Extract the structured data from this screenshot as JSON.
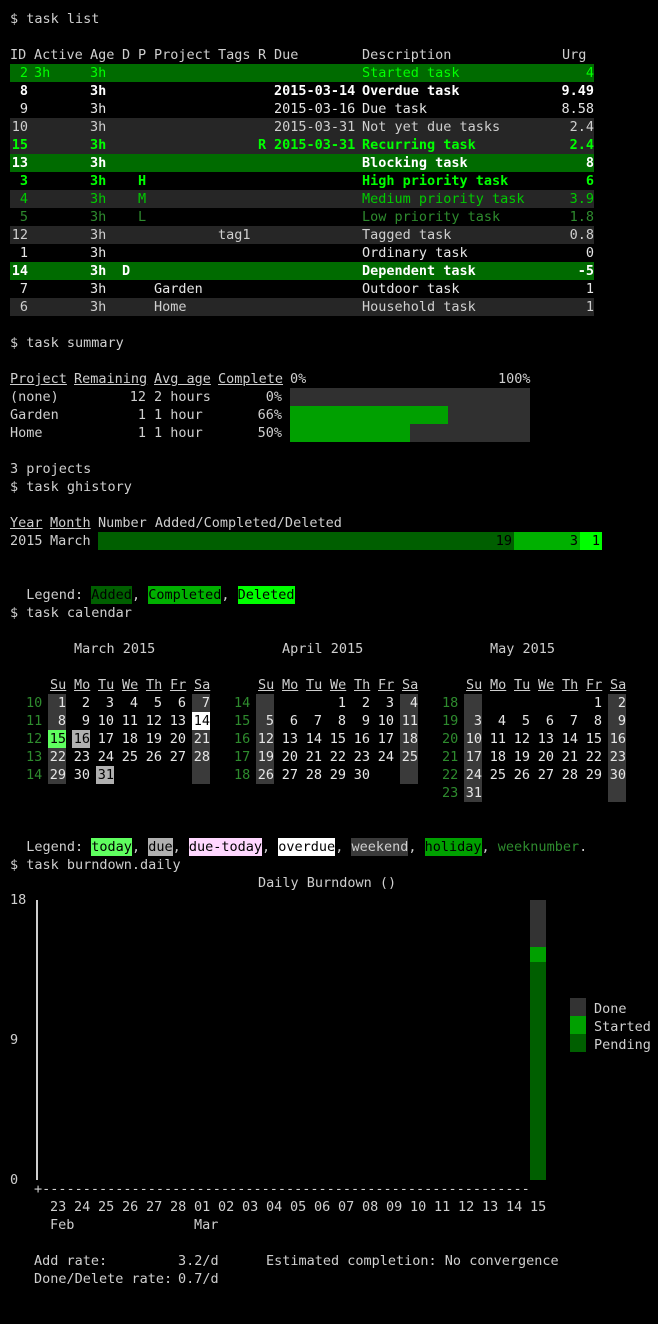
{
  "colors": {
    "background": "#000000",
    "text": "#cfcfcf",
    "gray_row": "#262626",
    "active_bg": "#006b00",
    "bright_green": "#00ff00",
    "mid_green": "#00cc00",
    "dark_green": "#2e8b2e",
    "bar_green": "#00a000",
    "bar_gray": "#303030",
    "added_green": "#005f00",
    "completed_green": "#00b000",
    "deleted_green": "#00ff00",
    "weekend_gray": "#3a3a3a",
    "weeknumber": "#2e8b2e",
    "today": "#5fff5f",
    "due": "#b0b0b0",
    "due_today": "#ffd7ff",
    "overdue": "#ffffff",
    "holiday": "#00a000"
  },
  "list": {
    "command": "$ task list",
    "headers": {
      "id": "ID",
      "active": "Active",
      "age": "Age",
      "d": "D",
      "p": "P",
      "project": "Project",
      "tags": "Tags",
      "r": "R",
      "due": "Due",
      "desc": "Description",
      "urg": "Urg"
    },
    "rows": [
      {
        "id": "2",
        "active": "3h",
        "age": "3h",
        "d": "",
        "p": "",
        "project": "",
        "tags": "",
        "r": "",
        "due": "",
        "desc": "Started task",
        "urg": "4",
        "style": "active"
      },
      {
        "id": "8",
        "active": "",
        "age": "3h",
        "d": "",
        "p": "",
        "project": "",
        "tags": "",
        "r": "",
        "due": "2015-03-14",
        "desc": "Overdue task",
        "urg": "9.49",
        "style": "overdue"
      },
      {
        "id": "9",
        "active": "",
        "age": "3h",
        "d": "",
        "p": "",
        "project": "",
        "tags": "",
        "r": "",
        "due": "2015-03-16",
        "desc": "Due task",
        "urg": "8.58",
        "style": "plain"
      },
      {
        "id": "10",
        "active": "",
        "age": "3h",
        "d": "",
        "p": "",
        "project": "",
        "tags": "",
        "r": "",
        "due": "2015-03-31",
        "desc": "Not yet due tasks",
        "urg": "2.4",
        "style": "gray"
      },
      {
        "id": "15",
        "active": "",
        "age": "3h",
        "d": "",
        "p": "",
        "project": "",
        "tags": "",
        "r": "R",
        "due": "2015-03-31",
        "desc": "Recurring task",
        "urg": "2.4",
        "style": "recurring"
      },
      {
        "id": "13",
        "active": "",
        "age": "3h",
        "d": "",
        "p": "",
        "project": "",
        "tags": "",
        "r": "",
        "due": "",
        "desc": "Blocking task",
        "urg": "8",
        "style": "blocking"
      },
      {
        "id": "3",
        "active": "",
        "age": "3h",
        "d": "",
        "p": "H",
        "project": "",
        "tags": "",
        "r": "",
        "due": "",
        "desc": "High priority task",
        "urg": "6",
        "style": "high"
      },
      {
        "id": "4",
        "active": "",
        "age": "3h",
        "d": "",
        "p": "M",
        "project": "",
        "tags": "",
        "r": "",
        "due": "",
        "desc": "Medium priority task",
        "urg": "3.9",
        "style": "medium"
      },
      {
        "id": "5",
        "active": "",
        "age": "3h",
        "d": "",
        "p": "L",
        "project": "",
        "tags": "",
        "r": "",
        "due": "",
        "desc": "Low priority task",
        "urg": "1.8",
        "style": "low"
      },
      {
        "id": "12",
        "active": "",
        "age": "3h",
        "d": "",
        "p": "",
        "project": "",
        "tags": "tag1",
        "r": "",
        "due": "",
        "desc": "Tagged task",
        "urg": "0.8",
        "style": "gray"
      },
      {
        "id": "1",
        "active": "",
        "age": "3h",
        "d": "",
        "p": "",
        "project": "",
        "tags": "",
        "r": "",
        "due": "",
        "desc": "Ordinary task",
        "urg": "0",
        "style": "plain"
      },
      {
        "id": "14",
        "active": "",
        "age": "3h",
        "d": "D",
        "p": "",
        "project": "",
        "tags": "",
        "r": "",
        "due": "",
        "desc": "Dependent task",
        "urg": "-5",
        "style": "dependent"
      },
      {
        "id": "7",
        "active": "",
        "age": "3h",
        "d": "",
        "p": "",
        "project": "Garden",
        "tags": "",
        "r": "",
        "due": "",
        "desc": "Outdoor task",
        "urg": "1",
        "style": "plain"
      },
      {
        "id": "6",
        "active": "",
        "age": "3h",
        "d": "",
        "p": "",
        "project": "Home",
        "tags": "",
        "r": "",
        "due": "",
        "desc": "Household task",
        "urg": "1",
        "style": "gray"
      }
    ]
  },
  "summary": {
    "command": "$ task summary",
    "headers": {
      "project": "Project",
      "remaining": "Remaining",
      "avg_age": "Avg age",
      "complete": "Complete",
      "pct0": "0%",
      "pct100": "100%"
    },
    "rows": [
      {
        "project": "(none)",
        "remaining": "12",
        "avg_age": "2 hours",
        "complete": "0%",
        "fraction": 0.0
      },
      {
        "project": "Garden",
        "remaining": "1",
        "avg_age": "1 hour",
        "complete": "66%",
        "fraction": 0.66
      },
      {
        "project": "Home",
        "remaining": "1",
        "avg_age": "1 hour",
        "complete": "50%",
        "fraction": 0.5
      }
    ],
    "footer": "3 projects"
  },
  "ghistory": {
    "command": "$ task ghistory",
    "headers": {
      "year": "Year",
      "month": "Month",
      "number": "Number Added/Completed/Deleted"
    },
    "row": {
      "year": "2015",
      "month": "March",
      "added": 19,
      "completed": 3,
      "deleted": 1,
      "added_label": "19",
      "completed_label": "3",
      "deleted_label": "1"
    },
    "legend_prefix": "Legend: ",
    "legend": [
      "Added",
      "Completed",
      "Deleted"
    ]
  },
  "calendar": {
    "command": "$ task calendar",
    "weekday_labels": [
      "Su",
      "Mo",
      "Tu",
      "We",
      "Th",
      "Fr",
      "Sa"
    ],
    "months": [
      {
        "title": "March 2015",
        "weeks": [
          {
            "wn": "10",
            "days": [
              "1",
              "2",
              "3",
              "4",
              "5",
              "6",
              "7"
            ]
          },
          {
            "wn": "11",
            "days": [
              "8",
              "9",
              "10",
              "11",
              "12",
              "13",
              "14"
            ]
          },
          {
            "wn": "12",
            "days": [
              "15",
              "16",
              "17",
              "18",
              "19",
              "20",
              "21"
            ]
          },
          {
            "wn": "13",
            "days": [
              "22",
              "23",
              "24",
              "25",
              "26",
              "27",
              "28"
            ]
          },
          {
            "wn": "14",
            "days": [
              "29",
              "30",
              "31",
              "",
              "",
              "",
              ""
            ]
          }
        ]
      },
      {
        "title": "April 2015",
        "weeks": [
          {
            "wn": "14",
            "days": [
              "",
              "",
              "",
              "1",
              "2",
              "3",
              "4"
            ]
          },
          {
            "wn": "15",
            "days": [
              "5",
              "6",
              "7",
              "8",
              "9",
              "10",
              "11"
            ]
          },
          {
            "wn": "16",
            "days": [
              "12",
              "13",
              "14",
              "15",
              "16",
              "17",
              "18"
            ]
          },
          {
            "wn": "17",
            "days": [
              "19",
              "20",
              "21",
              "22",
              "23",
              "24",
              "25"
            ]
          },
          {
            "wn": "18",
            "days": [
              "26",
              "27",
              "28",
              "29",
              "30",
              "",
              ""
            ]
          }
        ]
      },
      {
        "title": "May 2015",
        "weeks": [
          {
            "wn": "18",
            "days": [
              "",
              "",
              "",
              "",
              "",
              "1",
              "2"
            ]
          },
          {
            "wn": "19",
            "days": [
              "3",
              "4",
              "5",
              "6",
              "7",
              "8",
              "9"
            ]
          },
          {
            "wn": "20",
            "days": [
              "10",
              "11",
              "12",
              "13",
              "14",
              "15",
              "16"
            ]
          },
          {
            "wn": "21",
            "days": [
              "17",
              "18",
              "19",
              "20",
              "21",
              "22",
              "23"
            ]
          },
          {
            "wn": "22",
            "days": [
              "24",
              "25",
              "26",
              "27",
              "28",
              "29",
              "30"
            ]
          },
          {
            "wn": "23",
            "days": [
              "31",
              "",
              "",
              "",
              "",
              "",
              ""
            ]
          }
        ]
      }
    ],
    "special_days": {
      "today": "2015-03-15",
      "due": "2015-03-16",
      "overdue": "2015-03-14",
      "due_and_overdue_gray": "2015-03-31"
    },
    "legend_prefix": "Legend: ",
    "legend": [
      {
        "label": "today",
        "style": "today"
      },
      {
        "label": "due",
        "style": "due"
      },
      {
        "label": "due-today",
        "style": "due_today"
      },
      {
        "label": "overdue",
        "style": "overdue"
      },
      {
        "label": "weekend",
        "style": "weekend"
      },
      {
        "label": "holiday",
        "style": "holiday"
      },
      {
        "label": "weeknumber",
        "style": "weeknumber"
      }
    ]
  },
  "burndown": {
    "command": "$ task burndown.daily",
    "title": "Daily Burndown ()",
    "y_ticks": [
      "18",
      "9",
      "0"
    ],
    "x_days": [
      "23",
      "24",
      "25",
      "26",
      "27",
      "28",
      "01",
      "02",
      "03",
      "04",
      "05",
      "06",
      "07",
      "08",
      "09",
      "10",
      "11",
      "12",
      "13",
      "14",
      "15"
    ],
    "x_months": [
      "Feb",
      "Mar"
    ],
    "legend": [
      "Done",
      "Started",
      "Pending"
    ],
    "add_rate_label": "Add rate:",
    "add_rate_value": "3.2/d",
    "done_rate_label": "Done/Delete rate:",
    "done_rate_value": "0.7/d",
    "completion": "Estimated completion: No convergence"
  },
  "chart_data": {
    "type": "bar",
    "title": "Daily Burndown ()",
    "categories": [
      "23",
      "24",
      "25",
      "26",
      "27",
      "28",
      "01",
      "02",
      "03",
      "04",
      "05",
      "06",
      "07",
      "08",
      "09",
      "10",
      "11",
      "12",
      "13",
      "14",
      "15"
    ],
    "series": [
      {
        "name": "Pending",
        "values": [
          0,
          0,
          0,
          0,
          0,
          0,
          0,
          0,
          0,
          0,
          0,
          0,
          0,
          0,
          0,
          0,
          0,
          0,
          0,
          0,
          14
        ]
      },
      {
        "name": "Started",
        "values": [
          0,
          0,
          0,
          0,
          0,
          0,
          0,
          0,
          0,
          0,
          0,
          0,
          0,
          0,
          0,
          0,
          0,
          0,
          0,
          0,
          1
        ]
      },
      {
        "name": "Done",
        "values": [
          0,
          0,
          0,
          0,
          0,
          0,
          0,
          0,
          0,
          0,
          0,
          0,
          0,
          0,
          0,
          0,
          0,
          0,
          0,
          0,
          3
        ]
      }
    ],
    "ylim": [
      0,
      18
    ],
    "stacked": true
  }
}
